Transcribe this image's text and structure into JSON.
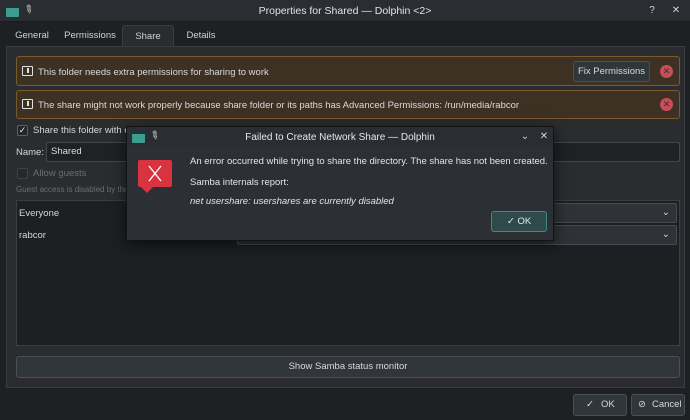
{
  "window": {
    "title": "Properties for Shared — Dolphin <2>",
    "pin_glyph": "📌"
  },
  "tabs": [
    {
      "label": "General"
    },
    {
      "label": "Permissions"
    },
    {
      "label": "Share"
    },
    {
      "label": "Details"
    }
  ],
  "warnings": [
    {
      "text": "This folder needs extra permissions for sharing to work",
      "button": "Fix Permissions"
    },
    {
      "text": "The share might not work properly because share folder or its paths has Advanced Permissions: /run/media/rabcor"
    }
  ],
  "share": {
    "share_checkbox_label": "Share this folder with o",
    "share_checked": true,
    "name_label": "Name:",
    "name_value": "Shared",
    "allow_guests_label": "Allow guests",
    "guest_note": "Guest access is disabled by the",
    "users": [
      {
        "name": "Everyone"
      },
      {
        "name": "rabcor"
      }
    ],
    "status_button": "Show Samba status monitor"
  },
  "footer": {
    "ok_label": "OK",
    "cancel_label": "Cancel"
  },
  "dialog": {
    "title": "Failed to Create Network Share — Dolphin",
    "message": "An error occurred while trying to share the directory. The share has not been created.",
    "report_label": "Samba internals report:",
    "report_detail": "net usershare: usershares are currently disabled",
    "ok_label": "OK"
  },
  "colors": {
    "warning_bg": "#3d3124",
    "error_red": "#da3340",
    "accent": "#3e8a8a"
  }
}
